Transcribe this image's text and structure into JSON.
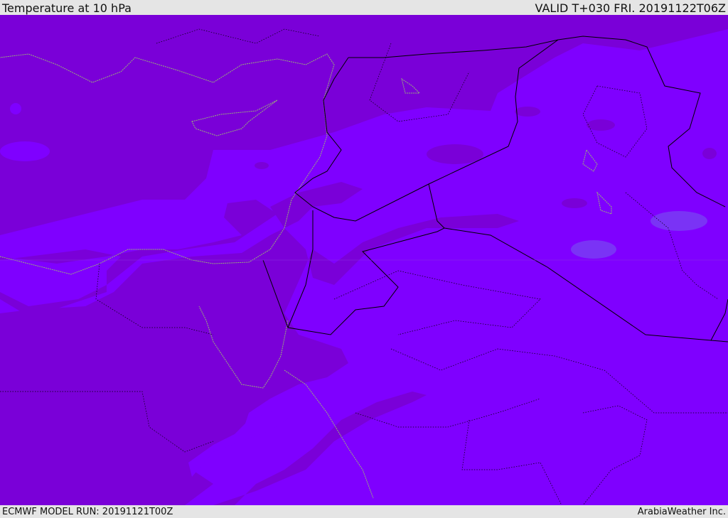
{
  "header": {
    "title": "Temperature at 10 hPa",
    "valid_time": "VALID T+030 FRI. 20191122T06Z"
  },
  "footer": {
    "model_run": "ECMWF MODEL RUN: 20191121T00Z",
    "credit": "ArabiaWeather Inc."
  },
  "colors": {
    "warmer_band": "#7a00d8",
    "colder_band": "#7f00ff",
    "coldest_patch": "#7a33f5",
    "coastline": "#9ab07a",
    "border": "#000000"
  }
}
